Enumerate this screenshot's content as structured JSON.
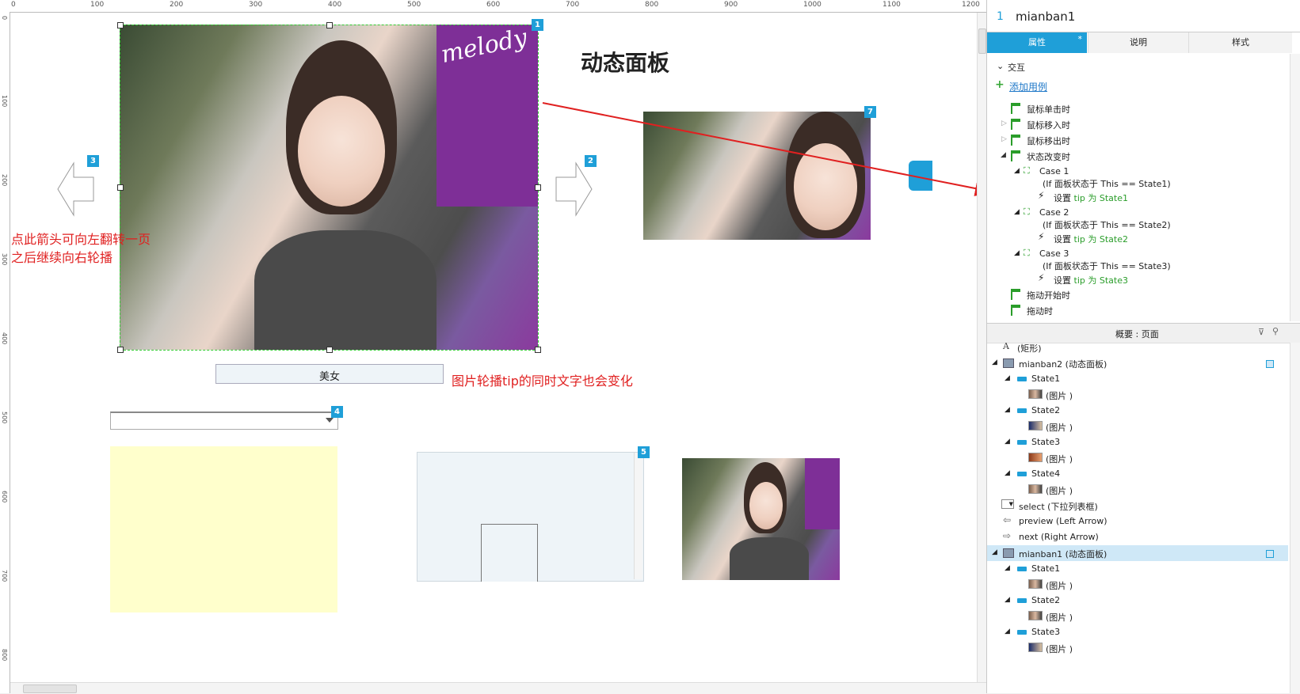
{
  "ruler": {
    "top_labels": [
      "0",
      "100",
      "200",
      "300",
      "400",
      "500",
      "600",
      "700",
      "800",
      "900",
      "1000",
      "1100",
      "1200"
    ],
    "left_labels": [
      "0",
      "100",
      "200",
      "300",
      "400",
      "500",
      "600",
      "700",
      "800"
    ]
  },
  "canvas": {
    "title": "动态面板",
    "caption_text": "美女",
    "hint_left_line1": "点此箭头可向左翻转一页",
    "hint_left_line2": "之后继续向右轮播",
    "hint_tip": "图片轮播tip的同时文字也会变化",
    "photo_brand": "melody",
    "badges": [
      "1",
      "2",
      "3",
      "4",
      "5",
      "7"
    ]
  },
  "panel": {
    "header_number": "1",
    "header_name": "mianban1",
    "tabs": [
      "属性",
      "说明",
      "样式"
    ],
    "tab_active_marker": "*",
    "section_interaction": "交互",
    "add_case_label": "添加用例",
    "events": [
      "鼠标单击时",
      "鼠标移入时",
      "鼠标移出时",
      "状态改变时"
    ],
    "cases": [
      {
        "name": "Case 1",
        "condition": "(If 面板状态于 This == State1)",
        "action_prefix": "设置 ",
        "action_target": "tip 为 State1"
      },
      {
        "name": "Case 2",
        "condition": "(If 面板状态于 This == State2)",
        "action_prefix": "设置 ",
        "action_target": "tip 为 State2"
      },
      {
        "name": "Case 3",
        "condition": "(If 面板状态于 This == State3)",
        "action_prefix": "设置 ",
        "action_target": "tip 为 State3"
      }
    ],
    "events_after": [
      "拖动开始时",
      "拖动时"
    ],
    "outline_title": "概要 : 页面",
    "outline": {
      "rect_label": "(矩形)",
      "mianban2": "mianban2 (动态面板)",
      "mianban2_states": [
        "State1",
        "State2",
        "State3",
        "State4"
      ],
      "image_label": "(图片 )",
      "select": "select (下拉列表框)",
      "preview": "preview (Left Arrow)",
      "next": "next (Right Arrow)",
      "mianban1": "mianban1 (动态面板)",
      "mianban1_states": [
        "State1",
        "State2",
        "State3"
      ]
    }
  },
  "colors": {
    "accent": "#1f9fd8",
    "hint_red": "#e02020",
    "action_green": "#2a9d2a",
    "selection_green": "#33cc33",
    "caption_bg": "#eef4f8",
    "yellow_box": "#ffffcc",
    "listbox_bg": "#eef4f8",
    "selected_row": "#cfe8f7"
  }
}
